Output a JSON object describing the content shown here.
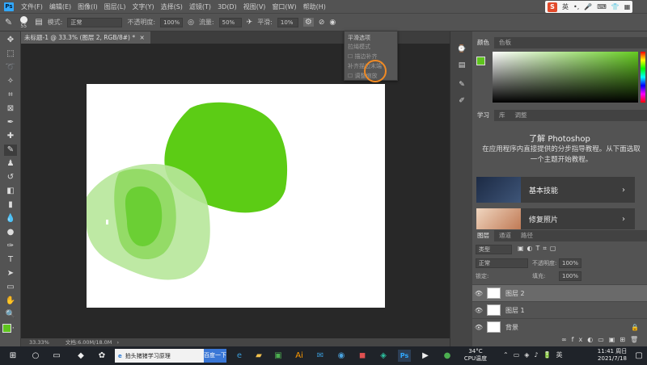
{
  "menubar": {
    "app_logo": "Ps",
    "items": [
      "文件(F)",
      "编辑(E)",
      "图像(I)",
      "图层(L)",
      "文字(Y)",
      "选择(S)",
      "滤镜(T)",
      "3D(D)",
      "视图(V)",
      "窗口(W)",
      "帮助(H)"
    ],
    "ime_logo": "S",
    "ime_label": "英"
  },
  "options_bar": {
    "brush_size": "55",
    "mode_label": "模式:",
    "mode_value": "正常",
    "opacity_label": "不透明度:",
    "opacity_value": "100%",
    "flow_label": "流量:",
    "flow_value": "50%",
    "smoothing_label": "平滑:",
    "smoothing_value": "10%"
  },
  "document_tab": {
    "title": "未标题-1 @ 33.3% (图层 2, RGB/8#) *",
    "close": "×"
  },
  "canvas_status": {
    "zoom": "33.33%",
    "doc_info": "文档:6.00M/18.0M"
  },
  "smoothing_popup": {
    "title": "平滑选项",
    "item_1": "拉绳模式",
    "item_2": "描边补齐",
    "item_3": "补齐描边末端",
    "item_4": "调整缩放"
  },
  "color_panel": {
    "tabs": [
      "颜色",
      "色板"
    ],
    "fg_color": "#5fc41e"
  },
  "learn_panel": {
    "tabs": [
      "学习",
      "库",
      "调整"
    ],
    "title": "了解 Photoshop",
    "description": "在应用程序内直接提供的分步指导教程。从下面选取一个主题开始教程。",
    "cards": [
      {
        "label": "基本技能"
      },
      {
        "label": "修复照片"
      }
    ]
  },
  "layers_panel": {
    "tabs": [
      "图层",
      "通道",
      "路径"
    ],
    "kind_filter": "类型",
    "blend_mode": "正常",
    "opacity_label": "不透明度:",
    "opacity_value": "100%",
    "lock_label": "锁定:",
    "fill_label": "填充:",
    "fill_value": "100%",
    "layers": [
      {
        "name": "图层 2",
        "selected": true
      },
      {
        "name": "图层 1",
        "selected": false
      },
      {
        "name": "背景",
        "selected": false
      }
    ]
  },
  "taskbar": {
    "search_text": "拍头猪猪学习原理",
    "search_button": "百度一下",
    "weather_temp": "34°C",
    "weather_label": "CPU温度",
    "time": "11:41 周日",
    "date": "2021/7/18"
  },
  "colors": {
    "accent_green": "#5fc41e",
    "highlight_ring": "#f08a24"
  }
}
